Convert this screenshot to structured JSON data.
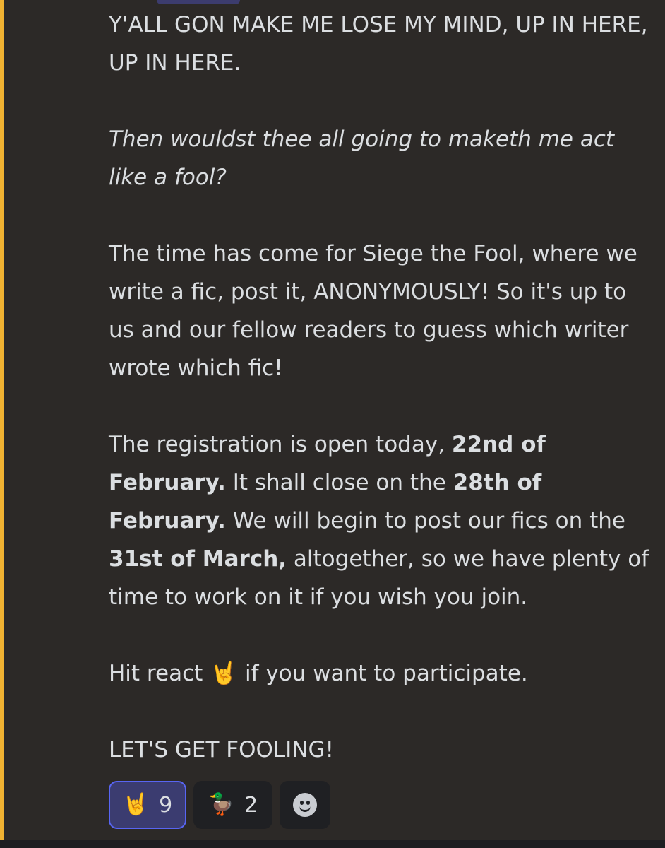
{
  "message": {
    "line1": "Y'ALL GON MAKE ME LOSE MY MIND, UP IN HERE, UP IN HERE.",
    "line2": "Then wouldst thee all going to maketh me act like a fool?",
    "para3": "The time has come for Siege the Fool, where we write a fic, post it, ANONYMOUSLY! So it's up to us and our fellow readers to guess which writer wrote which fic!",
    "para4": {
      "t1": "The registration is open today, ",
      "b1": "22nd of February.",
      "t2": " It shall close on the ",
      "b2": "28th of February.",
      "t3": " We will begin to post our fics on the ",
      "b3": "31st of March,",
      "t4": " altogether, so we have plenty of time to work on it if you wish you join."
    },
    "para5": {
      "before": "Hit react ",
      "emoji": "🤘",
      "after": " if you want to participate."
    },
    "para6": "LET'S GET FOOLING!"
  },
  "reactions": [
    {
      "emoji": "🤘",
      "count": "9",
      "active": true
    },
    {
      "emoji": "🦆",
      "count": "2",
      "active": false
    }
  ],
  "add_reaction_icon": "smiley-face-icon",
  "colors": {
    "background": "#2c2927",
    "mention_bar": "#f0b232",
    "text": "#dbdee1",
    "active_reaction_border": "#5865f2",
    "active_reaction_bg": "#3b3c70",
    "reaction_bg": "#1f2023"
  }
}
